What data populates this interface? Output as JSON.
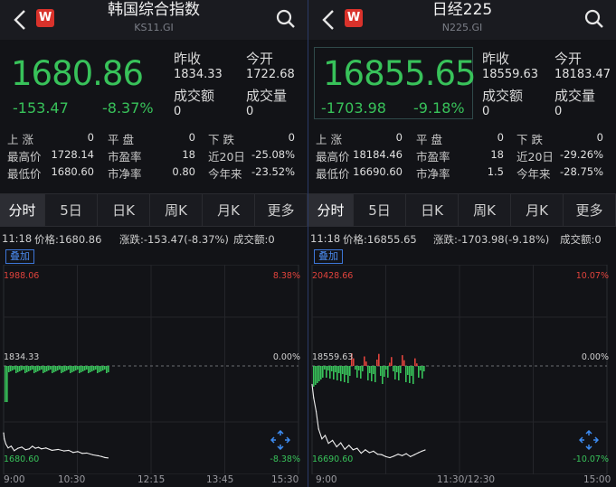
{
  "colors": {
    "up": "#e0433c",
    "down": "#38c25a",
    "accent": "#4b8bf0",
    "bg": "#121317"
  },
  "panels": [
    {
      "title": "韩国综合指数",
      "code": "KS11.GI",
      "price": "1680.86",
      "change": "-153.47",
      "change_pct": "-8.37%",
      "prev_close_label": "昨收",
      "prev_close": "1834.33",
      "open_label": "今开",
      "open": "1722.68",
      "amount_label": "成交额",
      "amount": "0",
      "volume_label": "成交量",
      "volume": "0",
      "stats": [
        {
          "label": "上 涨",
          "value": "0"
        },
        {
          "label": "平 盘",
          "value": "0"
        },
        {
          "label": "下 跌",
          "value": "0"
        },
        {
          "label": "最高价",
          "value": "1728.14"
        },
        {
          "label": "市盈率",
          "value": "18"
        },
        {
          "label": "近20日",
          "value": "-25.08%"
        },
        {
          "label": "最低价",
          "value": "1680.60"
        },
        {
          "label": "市净率",
          "value": "0.80"
        },
        {
          "label": "今年来",
          "value": "-23.52%"
        }
      ],
      "tabs": [
        "分时",
        "5日",
        "日K",
        "周K",
        "月K",
        "更多"
      ],
      "active_tab": 0,
      "time": "11:18",
      "price_line": "价格:1680.86",
      "chg_line": "涨跌:-153.47(-8.37%)",
      "amt_line": "成交额:0",
      "overlay_label": "叠加",
      "y_top": "1988.06",
      "y_mid": "1834.33",
      "y_bot": "1680.60",
      "pct_top": "8.38%",
      "pct_mid": "0.00%",
      "pct_bot": "-8.38%",
      "x_ticks": [
        "9:00",
        "10:30",
        "12:15",
        "13:45",
        "15:30"
      ],
      "chart_data": {
        "type": "line",
        "x_range": [
          "9:00",
          "15:30"
        ],
        "ylim": [
          1680.6,
          1988.06
        ],
        "series": [
          {
            "x": [
              "9:00",
              "9:01",
              "9:03",
              "9:06",
              "9:10",
              "9:14",
              "9:19",
              "9:24",
              "9:29",
              "9:34",
              "9:38",
              "9:42",
              "9:46",
              "9:50",
              "9:56",
              "10:04",
              "10:12",
              "10:20",
              "10:26",
              "10:32",
              "10:38",
              "10:44",
              "10:50",
              "10:58",
              "11:05",
              "11:10",
              "11:14",
              "11:18"
            ],
            "values": [
              1722.68,
              1712.5,
              1704.0,
              1697.5,
              1700.5,
              1693.0,
              1697.0,
              1699.0,
              1694.5,
              1696.0,
              1700.5,
              1697.0,
              1698.5,
              1696.0,
              1697.5,
              1693.5,
              1695.0,
              1692.5,
              1693.5,
              1690.0,
              1691.5,
              1688.5,
              1689.0,
              1686.0,
              1684.5,
              1683.0,
              1681.5,
              1680.86
            ]
          }
        ]
      }
    },
    {
      "title": "日经225",
      "code": "N225.GI",
      "price": "16855.65",
      "change": "-1703.98",
      "change_pct": "-9.18%",
      "prev_close_label": "昨收",
      "prev_close": "18559.63",
      "open_label": "今开",
      "open": "18183.47",
      "amount_label": "成交额",
      "amount": "0",
      "volume_label": "成交量",
      "volume": "0",
      "stats": [
        {
          "label": "上 涨",
          "value": "0"
        },
        {
          "label": "平 盘",
          "value": "0"
        },
        {
          "label": "下 跌",
          "value": "0"
        },
        {
          "label": "最高价",
          "value": "18184.46"
        },
        {
          "label": "市盈率",
          "value": "18"
        },
        {
          "label": "近20日",
          "value": "-29.26%"
        },
        {
          "label": "最低价",
          "value": "16690.60"
        },
        {
          "label": "市净率",
          "value": "1.5"
        },
        {
          "label": "今年来",
          "value": "-28.75%"
        }
      ],
      "tabs": [
        "分时",
        "5日",
        "日K",
        "周K",
        "月K",
        "更多"
      ],
      "active_tab": 0,
      "time": "11:18",
      "price_line": "价格:16855.65",
      "chg_line": "涨跌:-1703.98(-9.18%)",
      "amt_line": "成交额:0",
      "overlay_label": "叠加",
      "y_top": "20428.66",
      "y_mid": "18559.63",
      "y_bot": "16690.60",
      "pct_top": "10.07%",
      "pct_mid": "0.00%",
      "pct_bot": "-10.07%",
      "x_ticks": [
        "9:00",
        "11:30/12:30",
        "15:00"
      ],
      "chart_data": {
        "type": "line",
        "x_range": [
          "9:00",
          "15:00"
        ],
        "ylim": [
          16690.6,
          20428.66
        ],
        "series": [
          {
            "x": [
              "9:00",
              "9:02",
              "9:05",
              "9:08",
              "9:12",
              "9:16",
              "9:20",
              "9:25",
              "9:30",
              "9:35",
              "9:40",
              "9:45",
              "9:50",
              "9:55",
              "10:00",
              "10:05",
              "10:10",
              "10:15",
              "10:20",
              "10:25",
              "10:30",
              "10:35",
              "10:40",
              "10:45",
              "10:50",
              "10:55",
              "11:00",
              "11:05",
              "11:10",
              "11:14",
              "11:18"
            ],
            "values": [
              18183.47,
              17910,
              17640,
              17280,
              17080,
              17150,
              16990,
              17050,
              16920,
              17000,
              16870,
              16950,
              16860,
              16890,
              16790,
              16860,
              16800,
              16830,
              16770,
              16760,
              16720,
              16700,
              16730,
              16770,
              16740,
              16780,
              16720,
              16760,
              16800,
              16830,
              16855.65
            ]
          }
        ]
      }
    }
  ]
}
